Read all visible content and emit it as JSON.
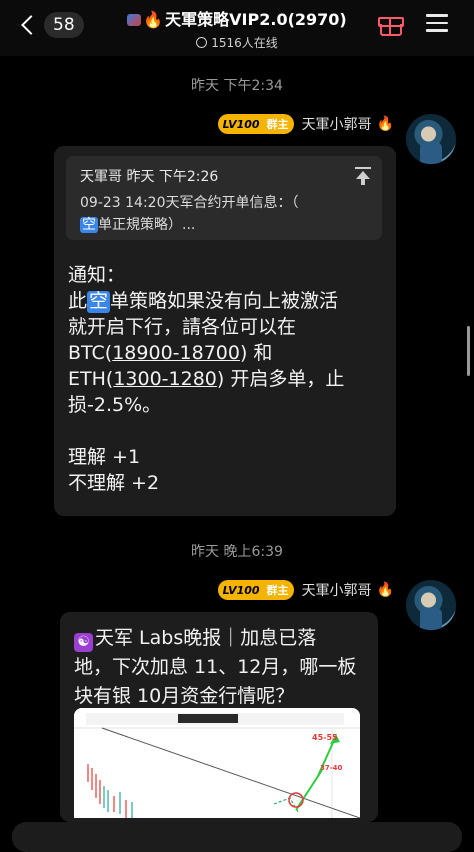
{
  "header": {
    "back_count": "58",
    "title": "天軍策略VIP2.0(2970)",
    "online_text": "1516人在线"
  },
  "messages": [
    {
      "time": "昨天 下午2:34",
      "sender": {
        "level": "LV100",
        "role": "群主",
        "name": "天軍小郭哥"
      },
      "quote": {
        "head": "天軍哥 昨天 下午2:26",
        "line1": "09-23 14:20天军合约开单信息：（",
        "kong": "空",
        "line2": "单正規策略）..."
      },
      "body": {
        "line1": "通知：",
        "line2_pre": "此",
        "line2_kong": "空",
        "line2_post": "单策略如果没有向上被激活",
        "line3": "就开启下行，請各位可以在",
        "line4_pre": "BTC(",
        "line4_u": "18900-18700",
        "line4_post": ") 和",
        "line5_pre": "ETH(",
        "line5_u": "1300-1280",
        "line5_post": ") 开启多单，止",
        "line6": "损-2.5%。",
        "line7": "理解 +1",
        "line8": "不理解 +2"
      }
    },
    {
      "time": "昨天 晚上6:39",
      "sender": {
        "level": "LV100",
        "role": "群主",
        "name": "天軍小郭哥"
      },
      "body": {
        "logo": "☯",
        "line1": "天军 Labs晚报｜加息已落",
        "line2": "地，下次加息 11、12月，哪一板",
        "line3": "块有银 10月资金行情呢？"
      },
      "chart_labels": {
        "upper": "45-55",
        "lower": "37-40"
      }
    }
  ],
  "colors": {
    "accent_blue": "#3a86e8",
    "badge_gold": "#f5b400",
    "fire": "#ff6a1a",
    "gift": "#ff5a6a"
  }
}
